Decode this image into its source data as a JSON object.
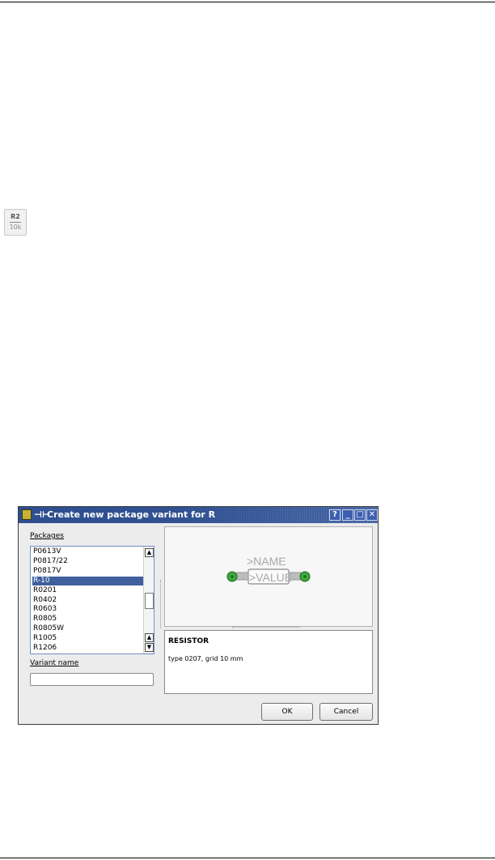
{
  "toolbar_icon": {
    "name": "R2",
    "value": "10k"
  },
  "dialog": {
    "title": "Create new package variant for R",
    "help_label": "?",
    "minimize_label": "_",
    "maximize_label": "□",
    "close_label": "✕",
    "packages_label": "Packages",
    "packages": [
      "P0613V",
      "P0817/22",
      "P0817V",
      "R-10",
      "R0201",
      "R0402",
      "R0603",
      "R0805",
      "R0805W",
      "R1005",
      "R1206"
    ],
    "selected_package": "R-10",
    "variant_name_label": "Variant name",
    "variant_name_value": "",
    "preview": {
      "name_text": ">NAME",
      "value_text": ">VALUE"
    },
    "description_title": "RESISTOR",
    "description_text": "type 0207, grid 10 mm",
    "ok_label": "OK",
    "cancel_label": "Cancel",
    "colors": {
      "titlebar": "#3f5f9d",
      "selection": "#3f5f9d",
      "pad": "#3ea83e"
    }
  }
}
